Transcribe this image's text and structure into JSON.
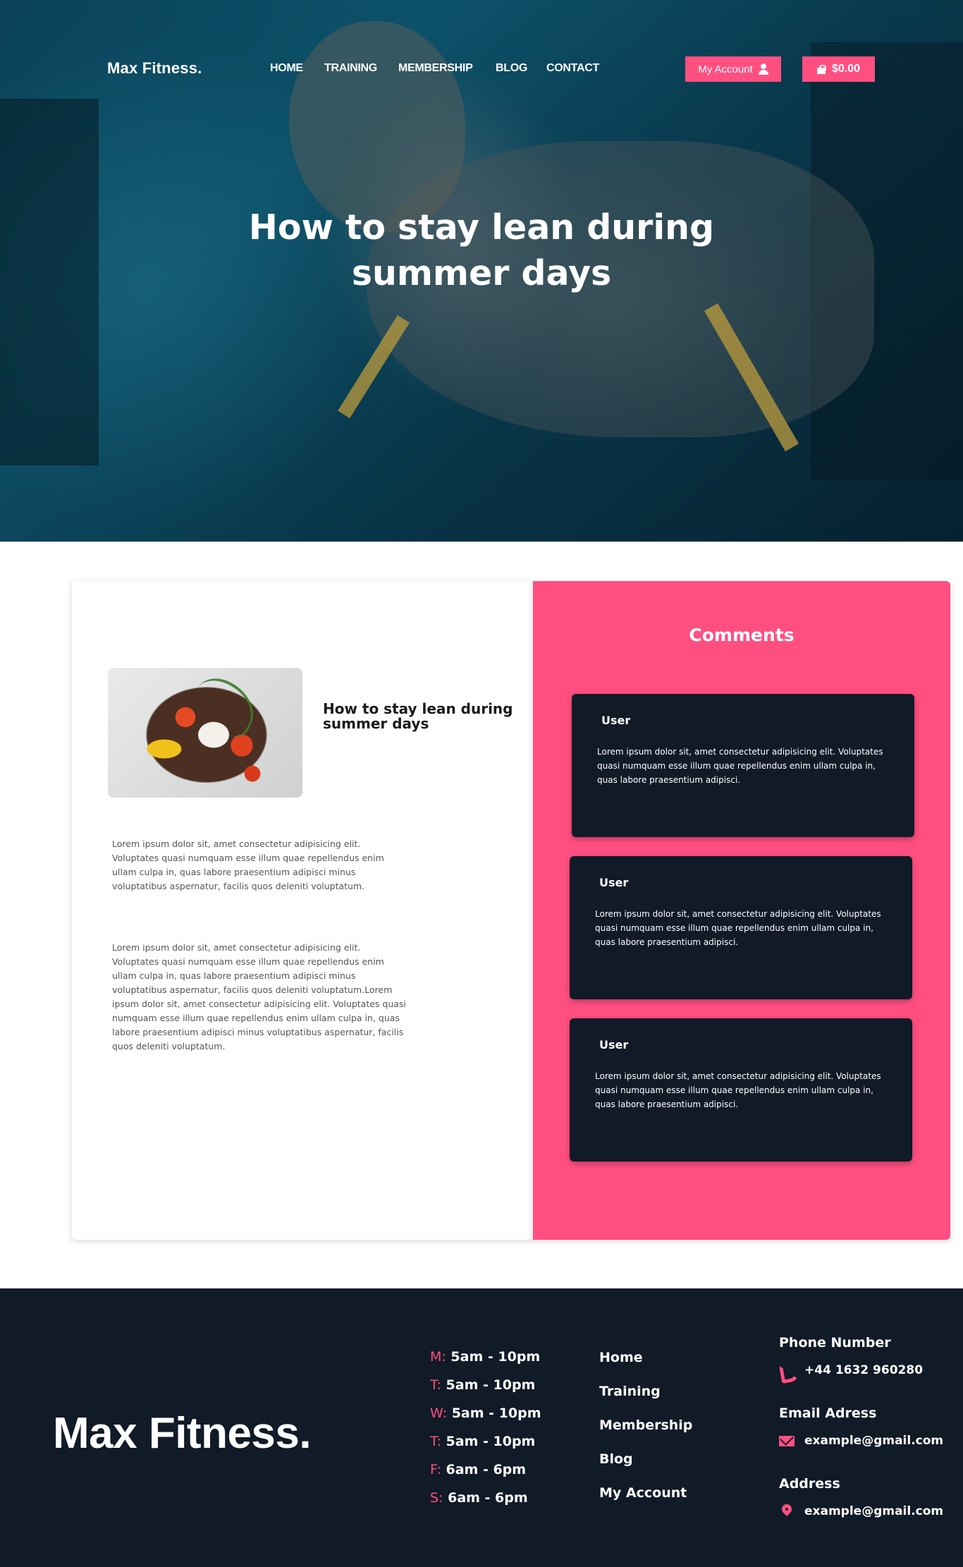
{
  "header": {
    "logo": "Max Fitness.",
    "nav": [
      "HOME",
      "TRAINING",
      "MEMBERSHIP",
      "BLOG",
      "CONTACT"
    ],
    "account_label": "My Account",
    "cart_total": "$0.00",
    "accent_color": "#ff4f81"
  },
  "hero": {
    "title": "How to stay lean during summer days"
  },
  "article": {
    "title": "How to stay lean during summer days",
    "image_icon": "food-plate-image",
    "paragraph1": "Lorem ipsum dolor sit, amet consectetur adipisicing elit. Voluptates quasi numquam esse illum quae repellendus enim ullam culpa in, quas labore praesentium adipisci minus voluptatibus aspernatur, facilis quos deleniti voluptatum.",
    "paragraph2": "Lorem ipsum dolor sit, amet consectetur adipisicing elit. Voluptates quasi numquam esse illum quae repellendus enim ullam culpa in, quas labore praesentium adipisci minus voluptatibus aspernatur, facilis quos deleniti voluptatum.Lorem ipsum dolor sit, amet consectetur adipisicing elit. Voluptates quasi numquam esse illum quae repellendus enim ullam culpa in, quas labore praesentium adipisci minus voluptatibus aspernatur, facilis quos deleniti voluptatum."
  },
  "comments": {
    "title": "Comments",
    "items": [
      {
        "user": "User",
        "text": "Lorem ipsum dolor sit, amet consectetur adipisicing elit. Voluptates quasi numquam esse illum quae repellendus enim ullam culpa in, quas labore praesentium adipisci."
      },
      {
        "user": "User",
        "text": "Lorem ipsum dolor sit, amet consectetur adipisicing elit. Voluptates quasi numquam esse illum quae repellendus enim ullam culpa in, quas labore praesentium adipisci."
      },
      {
        "user": "User",
        "text": "Lorem ipsum dolor sit, amet consectetur adipisicing elit. Voluptates quasi numquam esse illum quae repellendus enim ullam culpa in, quas labore praesentium adipisci."
      }
    ]
  },
  "footer": {
    "logo": "Max Fitness.",
    "hours": [
      {
        "day": "M:",
        "time": "5am - 10pm"
      },
      {
        "day": "T:",
        "time": "5am - 10pm"
      },
      {
        "day": "W:",
        "time": "5am - 10pm"
      },
      {
        "day": "T:",
        "time": "5am - 10pm"
      },
      {
        "day": "F:",
        "time": "6am - 6pm"
      },
      {
        "day": "S:",
        "time": "6am - 6pm"
      }
    ],
    "links": [
      "Home",
      "Training",
      "Membership",
      "Blog",
      "My Account"
    ],
    "phone_heading": "Phone Number",
    "phone": "+44 1632 960280",
    "email_heading": "Email Adress",
    "email": "example@gmail.com",
    "address_heading": "Address",
    "address": "example@gmail.com"
  }
}
